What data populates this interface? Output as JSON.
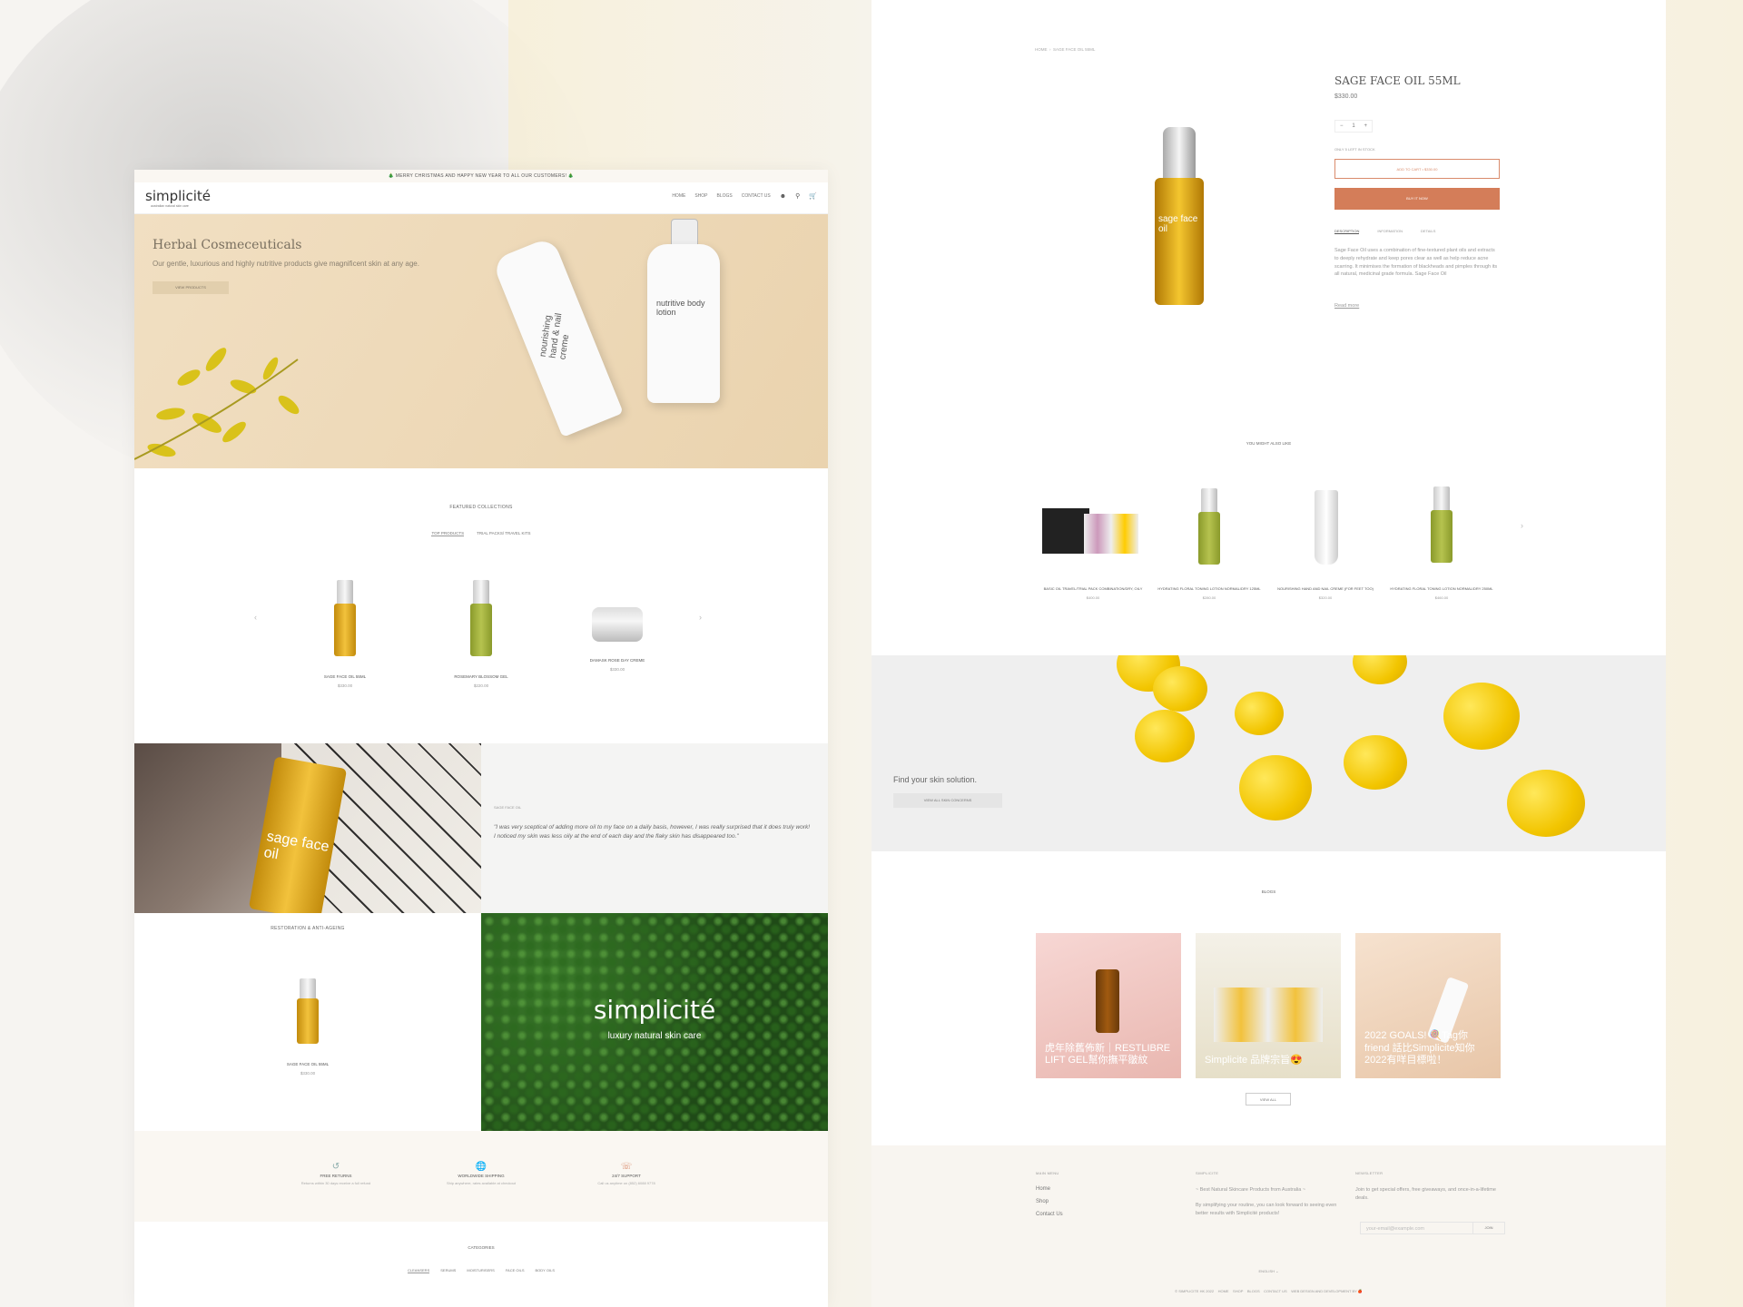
{
  "announcement": "🎄 MERRY CHRISTMAS AND HAPPY NEW YEAR TO ALL OUR CUSTOMERS! 🎄",
  "header": {
    "logo": "simplicité",
    "logo_sub": "australian natural skin care",
    "nav": [
      "HOME",
      "SHOP",
      "BLOGS",
      "CONTACT US"
    ],
    "icons": [
      "user-icon",
      "search-icon",
      "cart-icon"
    ]
  },
  "hero": {
    "title": "Herbal Cosmeceuticals",
    "subtitle": "Our gentle, luxurious and highly nutritive products give magnificent skin at any age.",
    "button": "VIEW PRODUCTS",
    "tube_label": "nourishing hand & nail creme",
    "bottle_label": "nutritive body lotion"
  },
  "featured": {
    "title": "FEATURED COLLECTIONS",
    "tabs": [
      "TOP PRODUCTS",
      "TRIAL PACKS/ TRAVEL KITS"
    ],
    "products": [
      {
        "name": "SAGE FACE OIL 55ML",
        "price": "$330.00"
      },
      {
        "name": "ROSEMARY BLOSSOM GEL",
        "price": "$220.00"
      },
      {
        "name": "DAMASK ROSE DAY CREME",
        "price": "$330.00"
      }
    ]
  },
  "quote": {
    "image_label": "sage face oil",
    "label": "SAGE FACE OIL",
    "text": "\"I was very sceptical of adding more oil to my face on a daily basis, however, I was really surprised that it does truly work! I noticed my skin was less oily at the end of each day and the flaky skin has disappeared too.\""
  },
  "restoration": {
    "title": "RESTORATION & ANTI-AGEING",
    "product": {
      "name": "SAGE FACE OIL 55ML",
      "price": "$330.00"
    }
  },
  "brand_block": {
    "brand": "simplicité",
    "tagline": "luxury natural skin care"
  },
  "features": [
    {
      "icon": "returns-icon",
      "title": "FREE RETURNS",
      "sub": "Returns within 30 days receive a full refund"
    },
    {
      "icon": "shipping-icon",
      "title": "WORLDWIDE SHIPPING",
      "sub": "Ship anywhere, rates available at checkout"
    },
    {
      "icon": "support-icon",
      "title": "24/7 SUPPORT",
      "sub": "Call us anytime on (852) 6088 9778"
    }
  ],
  "categories": {
    "title": "CATEGORIES",
    "items": [
      "CLEANSERS",
      "SERUMS",
      "MOISTURISERS",
      "FACE OILS",
      "BODY OILS"
    ]
  },
  "product_page": {
    "breadcrumb": [
      "HOME",
      "SAGE FACE OIL 55ML"
    ],
    "bottle_label": "sage face oil",
    "title": "SAGE FACE OIL 55ML",
    "price": "$330.00",
    "qty": "1",
    "stock": "ONLY 5 LEFT IN STOCK",
    "add_to_cart": "ADD TO CART • $330.00",
    "buy_now": "BUY IT NOW",
    "tabs": [
      "DESCRIPTION",
      "INFORMATION",
      "DETAILS"
    ],
    "description": "Sage Face Oil uses a combination of fine-textured plant oils and extracts to deeply rehydrate and keep pores clear as well as help reduce acne scarring. It minimises the formation of blackheads and pimples through its all natural, medicinal grade formula. Sage Face Oil",
    "read_more": "Read more"
  },
  "related": {
    "title": "YOU MIGHT ALSO LIKE",
    "items": [
      {
        "name": "BASIC OIL TRAVEL/TRIAL PACK COMBINATION/DRY, OILY",
        "price": "$400.00"
      },
      {
        "name": "HYDRATING FLORAL TONING LOTION NORMAL/DRY 125ML",
        "price": "$280.00"
      },
      {
        "name": "NOURISHING HAND AND NAIL CREME (FOR FEET TOO)",
        "price": "$320.00"
      },
      {
        "name": "HYDRATING FLORAL TONING LOTION NORMAL/DRY 250ML",
        "price": "$460.00"
      }
    ]
  },
  "skin": {
    "text": "Find your skin solution.",
    "button": "VIEW ALL SKIN CONCERNS"
  },
  "blogs": {
    "title": "BLOGS",
    "items": [
      {
        "caption": "虎年除舊佈新｜RESTLIBRE LIFT GEL幫你撫平皺紋"
      },
      {
        "caption": "Simplicite 品牌宗旨😍"
      },
      {
        "caption": "2022 GOALS! 🍭Tag你friend 話比Simplicite知你2022有咩目標啦！"
      }
    ],
    "view_all": "VIEW ALL"
  },
  "footer": {
    "main_menu_title": "MAIN MENU",
    "main_menu": [
      "Home",
      "Shop",
      "Contact Us"
    ],
    "about_title": "SIMPLICITE",
    "about_text": "~ Best Natural Skincare Products from Australia ~",
    "about_text2": "By simplifying your routine, you can look forward to seeing even better results with Simplicité products!",
    "newsletter_title": "NEWSLETTER",
    "newsletter_text": "Join to get special offers, free giveaways, and once-in-a-lifetime deals.",
    "newsletter_placeholder": "your-email@example.com",
    "join": "JOIN",
    "language": "ENGLISH ⌄",
    "copyright": "© SIMPLICITE HK 2022",
    "links": [
      "HOME",
      "SHOP",
      "BLOGS",
      "CONTACT US",
      "WEB DESIGN AND DEVELOPMENT BY 🍎"
    ]
  }
}
